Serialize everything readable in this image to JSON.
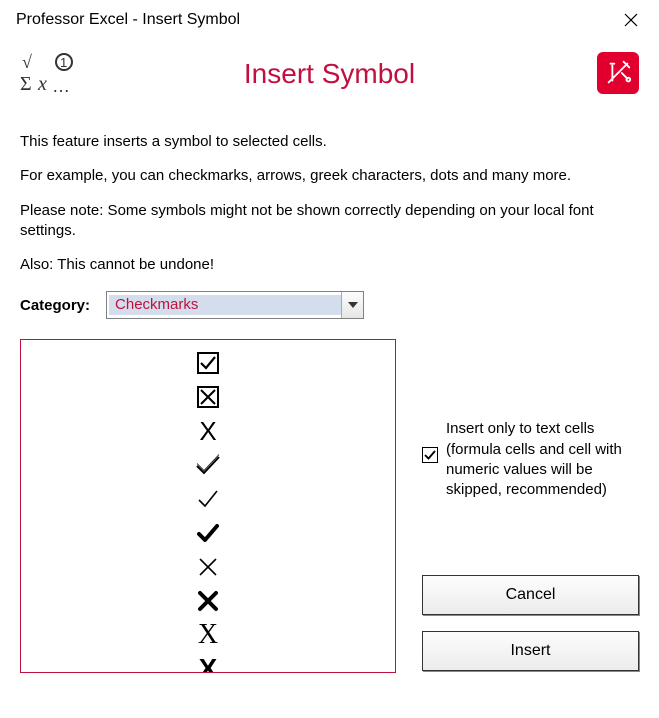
{
  "window": {
    "title": "Professor Excel - Insert Symbol"
  },
  "header": {
    "heading": "Insert Symbol",
    "left_icon": "insert-symbol-glyph",
    "right_icon": "brand-tools-glyph"
  },
  "description": {
    "p1": "This feature inserts a symbol to selected cells.",
    "p2": "For example, you can checkmarks, arrows, greek characters, dots and many more.",
    "p3": "Please note: Some symbols might not be shown correctly depending on your local font settings.",
    "p4": "Also: This cannot be undone!"
  },
  "category": {
    "label": "Category:",
    "selected": "Checkmarks"
  },
  "symbols": [
    "☑",
    "☒",
    "X",
    "✓",
    "✓",
    "✔",
    "✕",
    "✖",
    "✗",
    "✘"
  ],
  "symbol_variants": {
    "3": {
      "style": "outline-check"
    },
    "4": {
      "style": "thin-check"
    },
    "5": {
      "style": "bold-check"
    }
  },
  "option": {
    "checked": true,
    "label": "Insert only to text cells (formula cells and cell with numeric values will be skipped, recommended)"
  },
  "buttons": {
    "cancel": "Cancel",
    "insert": "Insert"
  }
}
